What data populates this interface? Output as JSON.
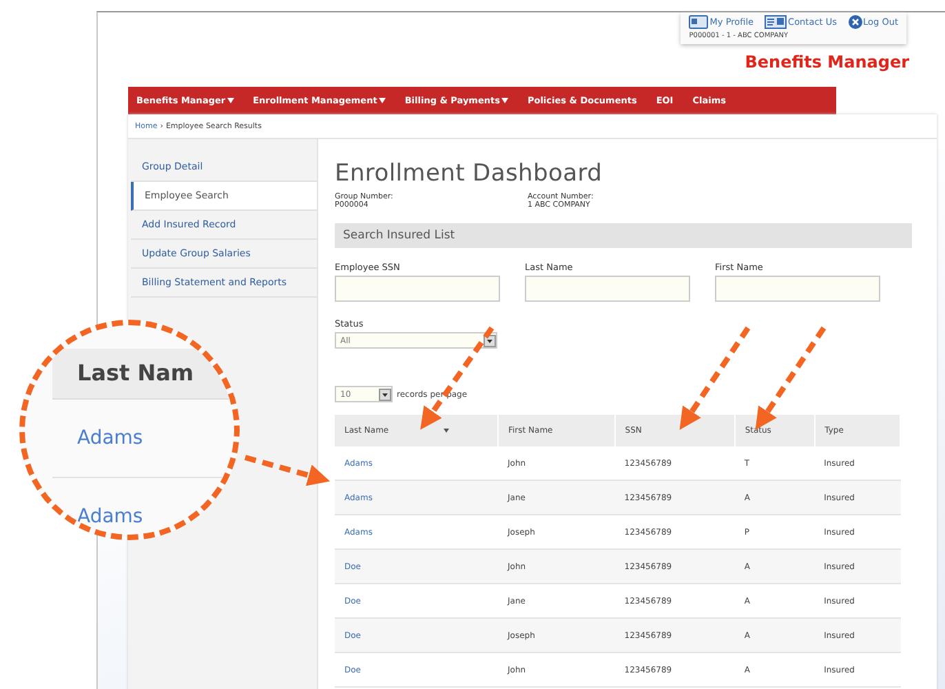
{
  "header": {
    "links": [
      {
        "kind": "profile",
        "label": "My Profile"
      },
      {
        "kind": "contact",
        "label": "Contact Us"
      },
      {
        "kind": "logout",
        "label": "Log Out"
      }
    ],
    "account_line": "P000001 - 1 - ABC COMPANY",
    "app_title": "Benefits Manager"
  },
  "nav": [
    {
      "label": "Benefits Manager",
      "dropdown": true
    },
    {
      "label": "Enrollment Management",
      "dropdown": true
    },
    {
      "label": "Billing & Payments",
      "dropdown": true
    },
    {
      "label": "Policies & Documents",
      "dropdown": false
    },
    {
      "label": "EOI",
      "dropdown": false
    },
    {
      "label": "Claims",
      "dropdown": false
    }
  ],
  "breadcrumb": {
    "home": "Home",
    "separator": "›",
    "current": "Employee Search Results"
  },
  "sidebar": {
    "items": [
      {
        "label": "Group Detail",
        "selected": false
      },
      {
        "label": "Employee Search",
        "selected": true
      },
      {
        "label": "Add Insured Record",
        "selected": false
      },
      {
        "label": "Update Group Salaries",
        "selected": false
      },
      {
        "label": "Billing Statement and Reports",
        "selected": false
      }
    ]
  },
  "main": {
    "title": "Enrollment Dashboard",
    "group_number": {
      "label": "Group Number:",
      "value": "P000004"
    },
    "account_number": {
      "label": "Account Number:",
      "value": "1 ABC COMPANY"
    },
    "search": {
      "title": "Search Insured List",
      "fields": [
        {
          "label": "Employee SSN"
        },
        {
          "label": "Last Name"
        },
        {
          "label": "First Name"
        }
      ],
      "status": {
        "label": "Status",
        "value": "All"
      }
    },
    "page_size": {
      "value": "10",
      "label": "records per page"
    },
    "table": {
      "columns": [
        {
          "label": "Last Name",
          "sorted": true
        },
        {
          "label": "First Name",
          "sorted": false
        },
        {
          "label": "SSN",
          "sorted": false
        },
        {
          "label": "Status",
          "sorted": false
        },
        {
          "label": "Type",
          "sorted": false
        }
      ],
      "rows": [
        [
          "Adams",
          "John",
          "123456789",
          "T",
          "Insured"
        ],
        [
          "Adams",
          "Jane",
          "123456789",
          "A",
          "Insured"
        ],
        [
          "Adams",
          "Joseph",
          "123456789",
          "P",
          "Insured"
        ],
        [
          "Doe",
          "John",
          "123456789",
          "A",
          "Insured"
        ],
        [
          "Doe",
          "Jane",
          "123456789",
          "A",
          "Insured"
        ],
        [
          "Doe",
          "Joseph",
          "123456789",
          "A",
          "Insured"
        ],
        [
          "Doe",
          "John",
          "123456789",
          "A",
          "Insured"
        ]
      ]
    }
  },
  "callout": {
    "header": "Last Nam",
    "rows": [
      "Adams",
      "Adams"
    ]
  }
}
